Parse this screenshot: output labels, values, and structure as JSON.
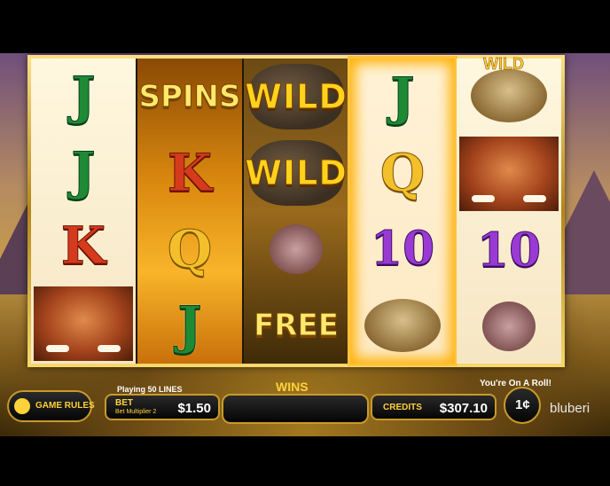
{
  "reels": [
    {
      "style": "light",
      "symbols": [
        {
          "kind": "letter",
          "text": "J",
          "color": "green"
        },
        {
          "kind": "letter",
          "text": "J",
          "color": "green"
        },
        {
          "kind": "letter",
          "text": "K",
          "color": "red"
        },
        {
          "kind": "mammoth"
        }
      ]
    },
    {
      "style": "fire",
      "symbols": [
        {
          "kind": "label",
          "text": "SPINS"
        },
        {
          "kind": "letter",
          "text": "K",
          "color": "red"
        },
        {
          "kind": "letter",
          "text": "Q",
          "color": "gold"
        },
        {
          "kind": "letter",
          "text": "J",
          "color": "green"
        }
      ]
    },
    {
      "style": "dark",
      "symbols": [
        {
          "kind": "wild",
          "text": "WILD"
        },
        {
          "kind": "wild",
          "text": "WILD"
        },
        {
          "kind": "dodo"
        },
        {
          "kind": "label",
          "text": "FREE"
        }
      ]
    },
    {
      "style": "glow",
      "symbols": [
        {
          "kind": "letter",
          "text": "J",
          "color": "green"
        },
        {
          "kind": "letter",
          "text": "Q",
          "color": "gold"
        },
        {
          "kind": "letter",
          "text": "10",
          "color": "purple"
        },
        {
          "kind": "armadillo"
        }
      ]
    },
    {
      "style": "light",
      "symbols": [
        {
          "kind": "armadillo"
        },
        {
          "kind": "mammoth"
        },
        {
          "kind": "letter",
          "text": "10",
          "color": "purple"
        },
        {
          "kind": "dodo"
        }
      ]
    }
  ],
  "top_wild_peek": "WILD",
  "status_message": "You're On A Roll!",
  "controls": {
    "game_rules": "GAME RULES",
    "playing_lines": "Playing 50 LINES",
    "bet_label": "BET",
    "bet_multiplier": "Bet Multiplier 2",
    "bet_value": "$1.50",
    "wins_label": "WINS",
    "wins_value": "",
    "credits_label": "CREDITS",
    "credits_value": "$307.10",
    "denomination": "1¢",
    "brand": "bluberi"
  },
  "colors": {
    "gold": "#ffd23a",
    "frame": "#c99a2b"
  }
}
